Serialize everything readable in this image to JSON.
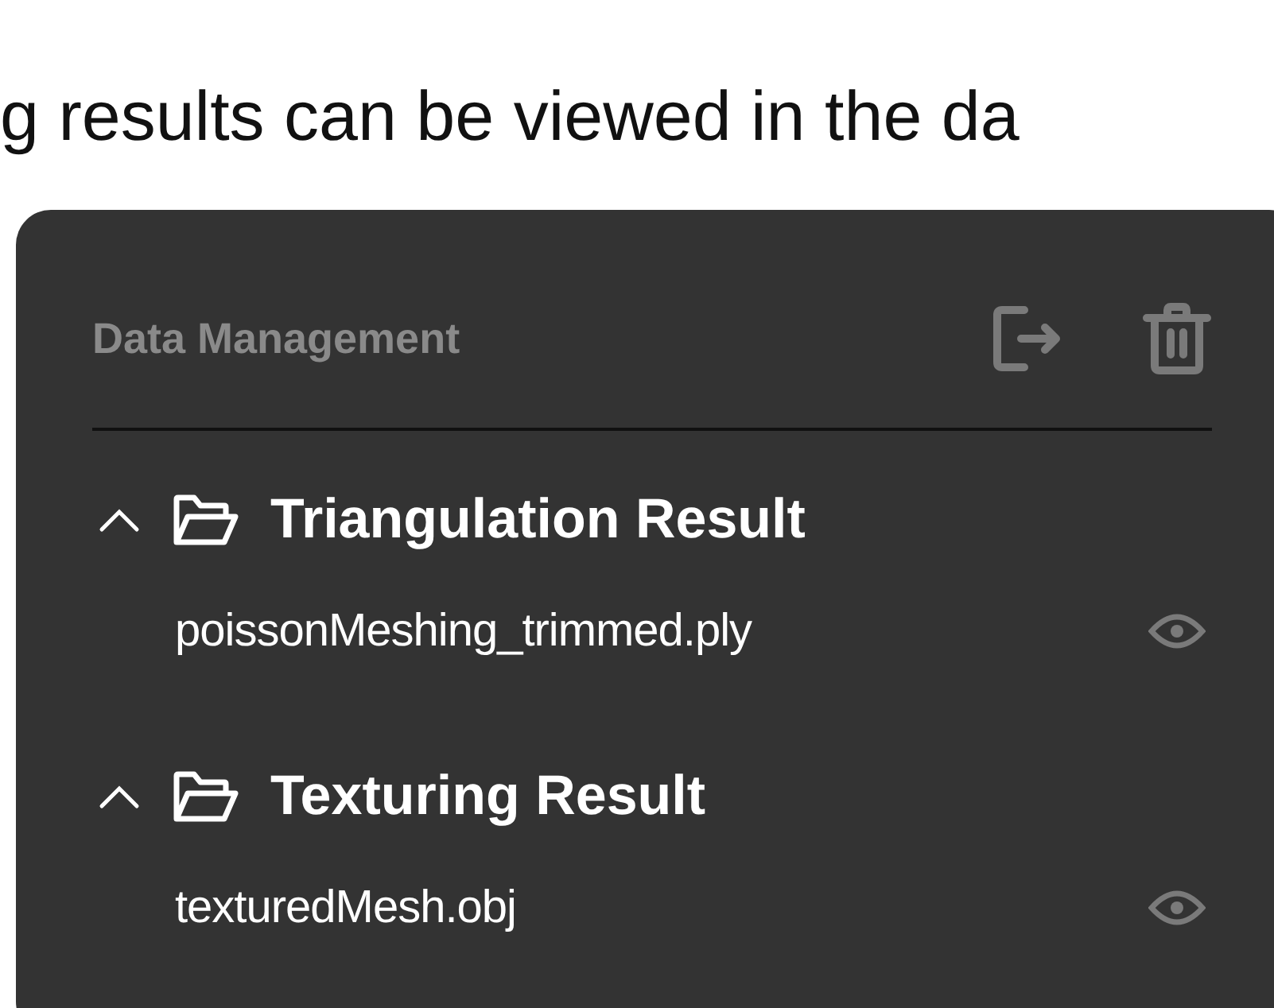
{
  "intro_text": "g results can be viewed in the da",
  "panel": {
    "title": "Data Management",
    "groups": [
      {
        "name": "Triangulation Result",
        "expanded": true,
        "files": [
          {
            "name": "poissonMeshing_trimmed.ply"
          }
        ]
      },
      {
        "name": "Texturing Result",
        "expanded": true,
        "files": [
          {
            "name": "texturedMesh.obj"
          }
        ]
      }
    ]
  }
}
